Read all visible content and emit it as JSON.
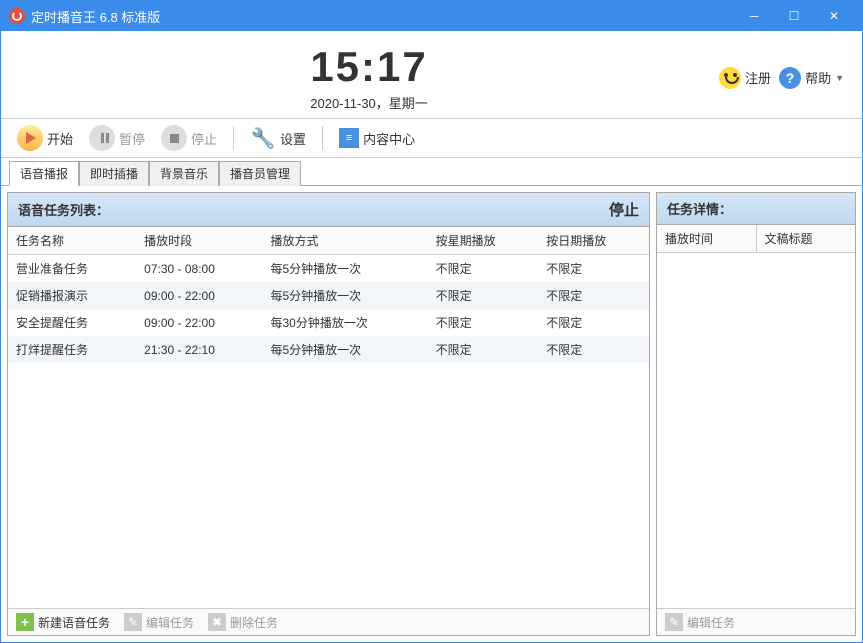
{
  "window": {
    "title": "定时播音王 6.8 标准版"
  },
  "clock": {
    "time": "15:17",
    "date": "2020-11-30，星期一"
  },
  "headerButtons": {
    "register": "注册",
    "help": "帮助"
  },
  "toolbar": {
    "start": "开始",
    "pause": "暂停",
    "stop": "停止",
    "settings": "设置",
    "content": "内容中心"
  },
  "tabs": [
    "语音播报",
    "即时插播",
    "背景音乐",
    "播音员管理"
  ],
  "leftPanel": {
    "title": "语音任务列表：",
    "status": "停止",
    "columns": [
      "任务名称",
      "播放时段",
      "播放方式",
      "按星期播放",
      "按日期播放"
    ],
    "rows": [
      {
        "name": "营业准备任务",
        "period": "07:30 - 08:00",
        "method": "每5分钟播放一次",
        "byWeek": "不限定",
        "byDate": "不限定"
      },
      {
        "name": "促销播报演示",
        "period": "09:00 - 22:00",
        "method": "每5分钟播放一次",
        "byWeek": "不限定",
        "byDate": "不限定"
      },
      {
        "name": "安全提醒任务",
        "period": "09:00 - 22:00",
        "method": "每30分钟播放一次",
        "byWeek": "不限定",
        "byDate": "不限定"
      },
      {
        "name": "打烊提醒任务",
        "period": "21:30 - 22:10",
        "method": "每5分钟播放一次",
        "byWeek": "不限定",
        "byDate": "不限定"
      }
    ],
    "footer": {
      "new": "新建语音任务",
      "edit": "编辑任务",
      "delete": "删除任务"
    }
  },
  "rightPanel": {
    "title": "任务详情：",
    "columns": [
      "播放时间",
      "文稿标题"
    ],
    "footer": {
      "edit": "编辑任务"
    }
  }
}
